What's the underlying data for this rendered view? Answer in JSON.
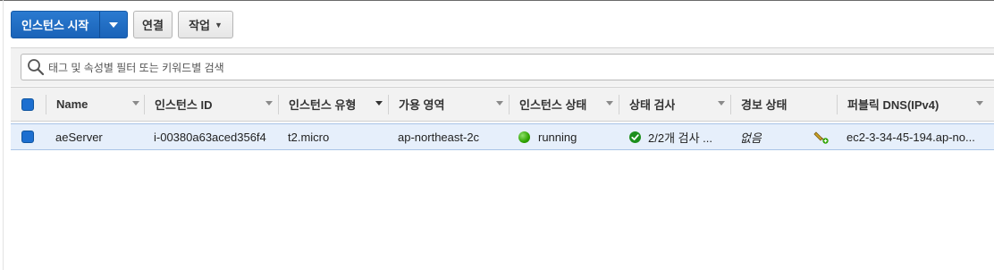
{
  "toolbar": {
    "launch_label": "인스턴스 시작",
    "connect_label": "연결",
    "actions_label": "작업"
  },
  "search": {
    "placeholder": "태그 및 속성별 필터 또는 키워드별 검색"
  },
  "table": {
    "columns": [
      "Name",
      "인스턴스 ID",
      "인스턴스 유형",
      "가용 영역",
      "인스턴스 상태",
      "상태 검사",
      "경보 상태",
      "퍼블릭 DNS(IPv4)"
    ],
    "rows": [
      {
        "name": "aeServer",
        "instance_id": "i-00380a63aced356f4",
        "instance_type": "t2.micro",
        "availability_zone": "ap-northeast-2c",
        "instance_state": "running",
        "status_check": "2/2개 검사 ...",
        "alarm_status": "없음",
        "public_dns": "ec2-3-34-45-194.ap-no..."
      }
    ]
  },
  "colors": {
    "primary": "#1a63b8",
    "row_selected": "#e6effb",
    "running_green": "#2ea300"
  }
}
